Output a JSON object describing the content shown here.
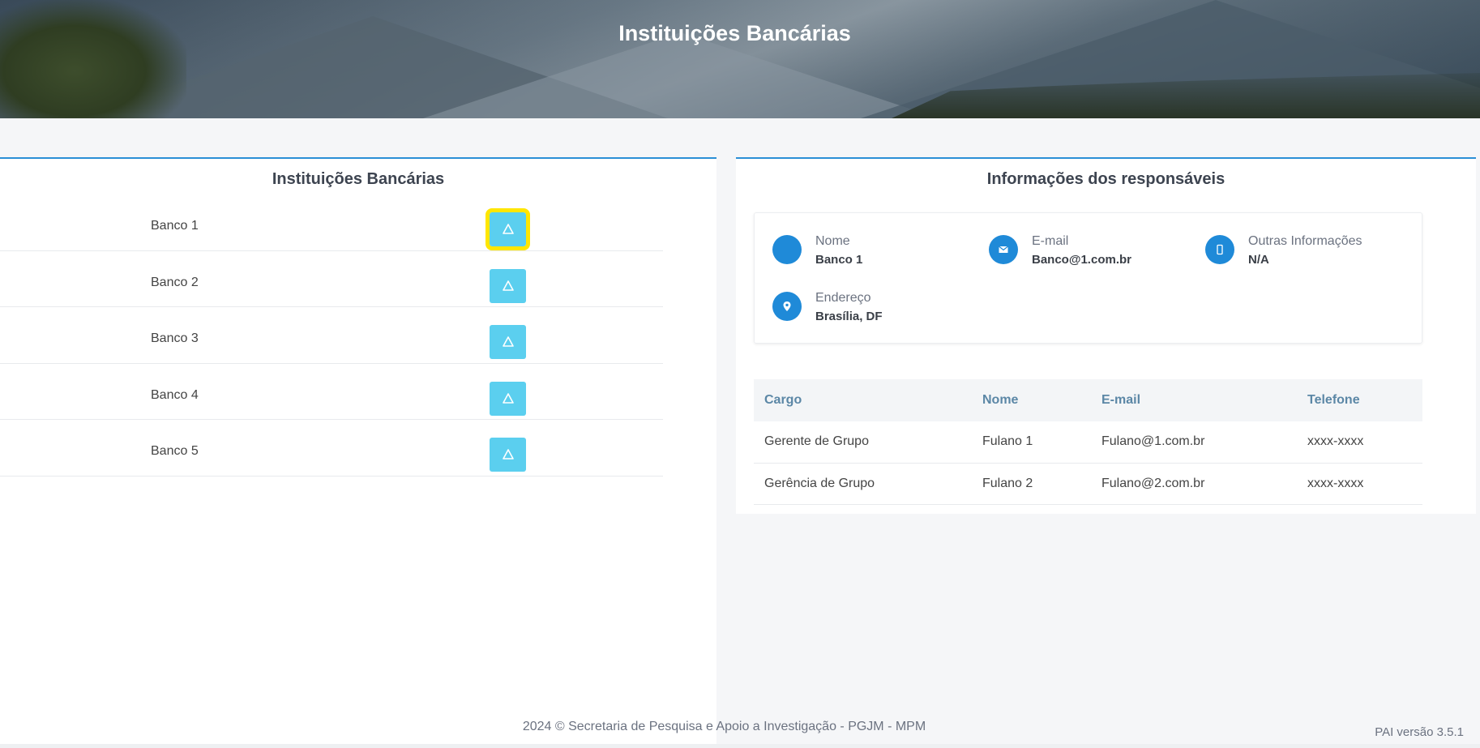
{
  "header": {
    "title": "Instituições Bancárias"
  },
  "banks_panel": {
    "title": "Instituições Bancárias",
    "banks": [
      {
        "name": "Banco 1",
        "selected": true
      },
      {
        "name": "Banco 2",
        "selected": false
      },
      {
        "name": "Banco 3",
        "selected": false
      },
      {
        "name": "Banco 4",
        "selected": false
      },
      {
        "name": "Banco 5",
        "selected": false
      }
    ],
    "button_icon": "triangle-icon"
  },
  "info_panel": {
    "title": "Informações dos responsáveis",
    "fields": {
      "nome": {
        "label": "Nome",
        "value": "Banco 1",
        "icon": "user-icon"
      },
      "email": {
        "label": "E-mail",
        "value": "Banco@1.com.br",
        "icon": "envelope-icon"
      },
      "outras": {
        "label": "Outras Informações",
        "value": "N/A",
        "icon": "phone-icon"
      },
      "endereco": {
        "label": "Endereço",
        "value": "Brasília, DF",
        "icon": "map-pin-icon"
      }
    },
    "table": {
      "headers": [
        "Cargo",
        "Nome",
        "E-mail",
        "Telefone"
      ],
      "rows": [
        [
          "Gerente de Grupo",
          "Fulano 1",
          "Fulano@1.com.br",
          "xxxx-xxxx"
        ],
        [
          "Gerência de Grupo",
          "Fulano 2",
          "Fulano@2.com.br",
          "xxxx-xxxx"
        ]
      ]
    }
  },
  "footer": {
    "text": "2024 © Secretaria de Pesquisa e Apoio a Investigação - PGJM - MPM",
    "version": "PAI versão 3.5.1"
  },
  "colors": {
    "accent": "#2b8fd6",
    "button": "#5bcfef",
    "highlight": "#ffe600",
    "icon_circle": "#1f8ad8"
  }
}
